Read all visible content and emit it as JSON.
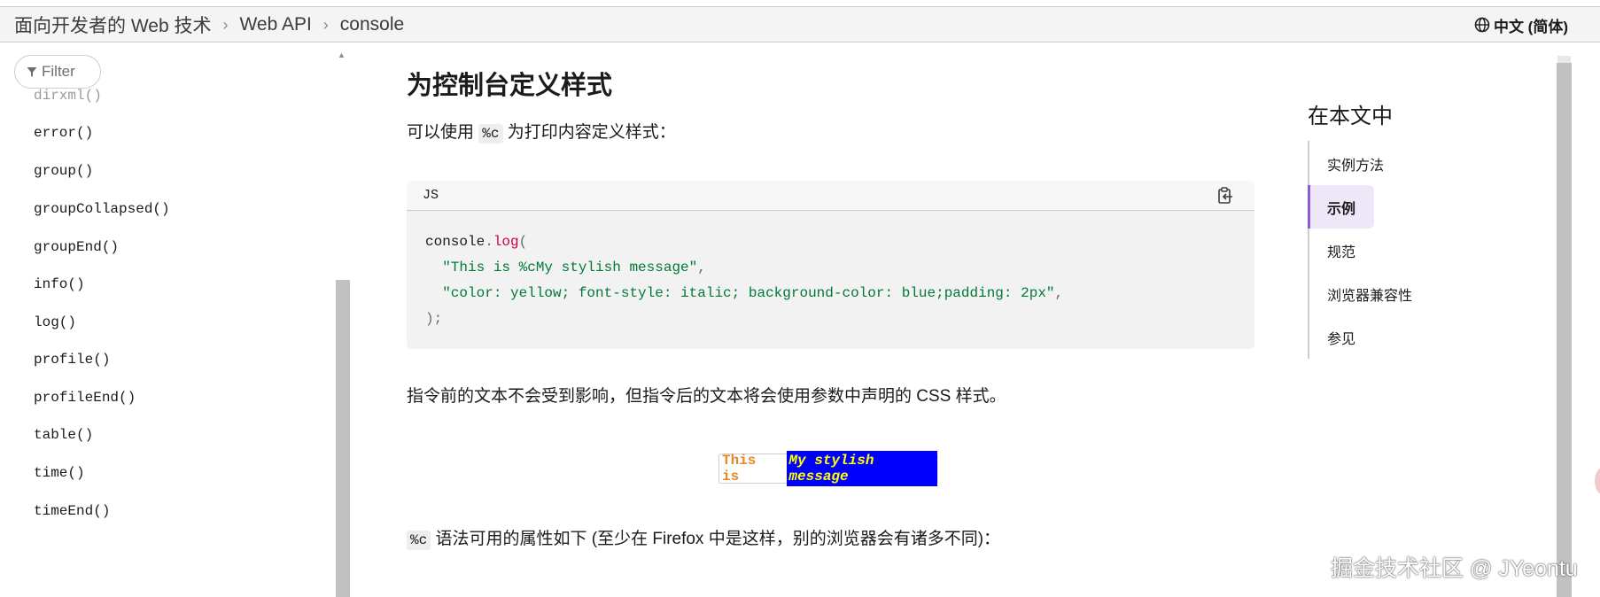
{
  "breadcrumb": {
    "items": [
      "面向开发者的 Web 技术",
      "Web API",
      "console"
    ],
    "separator": "›"
  },
  "language": {
    "label": "中文 (简体)"
  },
  "sidebar": {
    "filter_placeholder": "Filter",
    "items": [
      "dirxml()",
      "error()",
      "group()",
      "groupCollapsed()",
      "groupEnd()",
      "info()",
      "log()",
      "profile()",
      "profileEnd()",
      "table()",
      "time()",
      "timeEnd()"
    ]
  },
  "main": {
    "heading": "为控制台定义样式",
    "intro_before": "可以使用",
    "intro_code": "%c",
    "intro_after": "为打印内容定义样式：",
    "code": {
      "lang": "JS",
      "line1_obj": "console",
      "line1_dot": ".",
      "line1_fn": "log",
      "line1_paren": "(",
      "line2": "\"This is %cMy stylish message\"",
      "line2_comma": ",",
      "line3": "\"color: yellow; font-style: italic; background-color: blue;padding: 2px\"",
      "line3_comma": ",",
      "line4": ");"
    },
    "para2": "指令前的文本不会受到影响，但指令后的文本将会使用参数中声明的 CSS 样式。",
    "demo": {
      "plain": "This is",
      "styled": "My stylish message"
    },
    "para3_code": "%c",
    "para3_text": "语法可用的属性如下 (至少在 Firefox 中是这样，别的浏览器会有诸多不同)："
  },
  "toc": {
    "title": "在本文中",
    "items": [
      "实例方法",
      "示例",
      "规范",
      "浏览器兼容性",
      "参见"
    ],
    "active": "示例"
  },
  "watermark": "掘金技术社区 @ JYeontu",
  "colors": {
    "accent": "#8a5cd6",
    "code_function": "#d30038",
    "code_string": "#007936",
    "demo_text": "#ffff00",
    "demo_bg": "#0000ff"
  },
  "icons": [
    "globe-icon",
    "filter-icon",
    "copy-icon"
  ]
}
